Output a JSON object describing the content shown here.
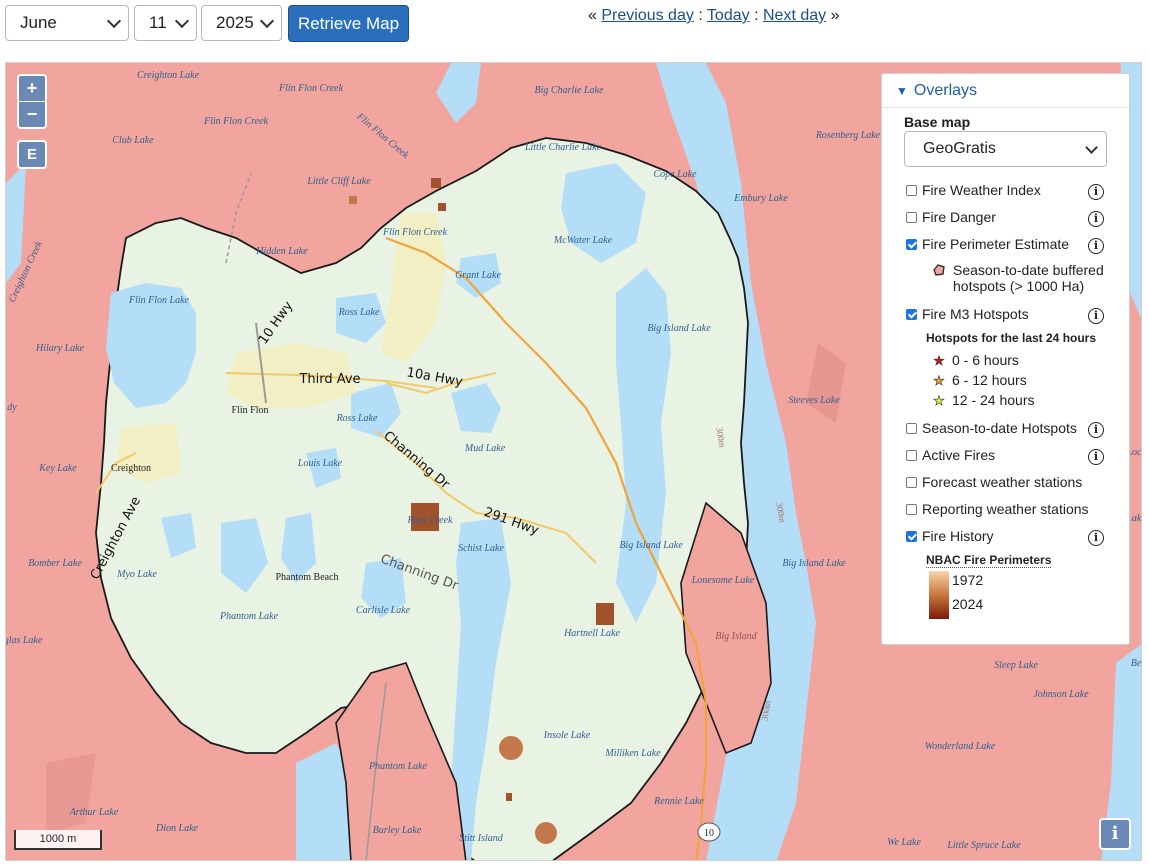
{
  "controls": {
    "month": "June",
    "day": "11",
    "year": "2025",
    "retrieve_label": "Retrieve Map",
    "nav_prefix": "«",
    "previous_day": "Previous day",
    "sep1": ":",
    "today": "Today",
    "sep2": ":",
    "next_day": "Next day",
    "nav_suffix": "»"
  },
  "map": {
    "zoom_in": "+",
    "zoom_out": "−",
    "extent_button": "E",
    "info_button": "i",
    "scale": "1000 m",
    "colors": {
      "water": "#b4def7",
      "land": "#e9f3e3",
      "buffer": "#f2a59f",
      "perimeter_line": "#1a1a1a",
      "fire_history": "#a0522d"
    },
    "labels": {
      "creighton_lake": "Creighton Lake",
      "flin_flon_creek_n": "Flin Flon Creek",
      "flin_flon_creek_w": "Flin Flon Creek",
      "flin_flon_creek_d": "Flin Flon Creek",
      "club_lake": "Club Lake",
      "little_cliff": "Little Cliff Lake",
      "hidden_lake": "Hidden Lake",
      "flin_flon_lake": "Flin Flon Lake",
      "creighton_creek": "Creighton Creek",
      "hilary_lake": "Hilary Lake",
      "ross_lake_n": "Ross Lake",
      "ross_lake_s": "Ross Lake",
      "big_charlie": "Big Charlie Lake",
      "little_charlie": "Little Charlie Lake",
      "cope_lake": "Cope Lake",
      "embury_lake": "Embury Lake",
      "rosenberg_lake": "Rosenberg Lake",
      "mcwater_lake": "McWater Lake",
      "flin_flon_creek_town": "Flin Flon Creek",
      "grant_lake": "Grant Lake",
      "big_island_lake_n": "Big Island Lake",
      "hwy10": "10 Hwy",
      "third_ave": "Third Ave",
      "hwy10a": "10a Hwy",
      "flin_flon": "Flin Flon",
      "creighton": "Creighton",
      "louis_lake": "Louis Lake",
      "mud_lake": "Mud Lake",
      "steeves_lake": "Steeves Lake",
      "channing_dr": "Channing Dr",
      "hwy291": "291 Hwy",
      "creighton_ave": "Creighton Ave",
      "key_lake": "Key Lake",
      "ross_creek": "Ross Creek",
      "schist_lake": "Schist Lake",
      "big_island_lake_c": "Big Island Lake",
      "big_island_lake_e": "Big Island Lake",
      "bomber_lake": "Bomber Lake",
      "myo_lake": "Myo Lake",
      "phantom_beach": "Phantom Beach",
      "channing_dr2": "Channing Dr",
      "lonesome_lake": "Lonesome Lake",
      "phantom_lake_w": "Phantom Lake",
      "carlisle_lake": "Carlisle Lake",
      "hartnell_lake": "Hartnell Lake",
      "big_island": "Big Island",
      "douglas_lake": "ouglas Lake",
      "sleep_lake": "Sleep Lake",
      "johnson_lake": "Johnson Lake",
      "insole_lake": "Insole Lake",
      "milliken_lake": "Milliken Lake",
      "wonderland_lake": "Wonderland Lake",
      "phantom_lake_s": "Phantom Lake",
      "arthur_lake": "Arthur Lake",
      "rennie_lake": "Rennie Lake",
      "dion_lake": "Dion Lake",
      "burley_lake": "Burley Lake",
      "stitt_island": "Stitt Island",
      "we_lake": "We Lake",
      "little_spruce": "Little Spruce Lake",
      "shield_10": "10",
      "contour_300_a": "300m",
      "contour_300_b": "300m",
      "contour_300_c": "300m",
      "ody": "dy",
      "loc": "Loc",
      "be": "Be",
      "lake_edge": "Lake"
    }
  },
  "panel": {
    "title": "Overlays",
    "base_map_label": "Base map",
    "base_map_value": "GeoGratis",
    "fire_weather_index": "Fire Weather Index",
    "fire_danger": "Fire Danger",
    "fire_perimeter": "Fire Perimeter Estimate",
    "perimeter_legend_1": "Season-to-date buffered",
    "perimeter_legend_2": "hotspots (> 1000 Ha)",
    "m3_hotspots": "Fire M3 Hotspots",
    "hotspots_heading": "Hotspots for the last 24 hours",
    "hs_0_6": "0 - 6 hours",
    "hs_6_12": "6 - 12 hours",
    "hs_12_24": "12 - 24 hours",
    "std_hotspots": "Season-to-date Hotspots",
    "active_fires": "Active Fires",
    "forecast_stations": "Forecast weather stations",
    "reporting_stations": "Reporting weather stations",
    "fire_history": "Fire History",
    "nbac_heading": "NBAC Fire Perimeters",
    "ramp_start": "1972",
    "ramp_end": "2024",
    "info_glyph": "i",
    "star_glyph": "★",
    "star_colors": {
      "0_6": "#d11a1a",
      "6_12": "#f0a020",
      "12_24": "#f4ef3a"
    },
    "checked": {
      "fire_weather_index": false,
      "fire_danger": false,
      "fire_perimeter": true,
      "m3_hotspots": true,
      "std_hotspots": false,
      "active_fires": false,
      "forecast_stations": false,
      "reporting_stations": false,
      "fire_history": true
    }
  }
}
